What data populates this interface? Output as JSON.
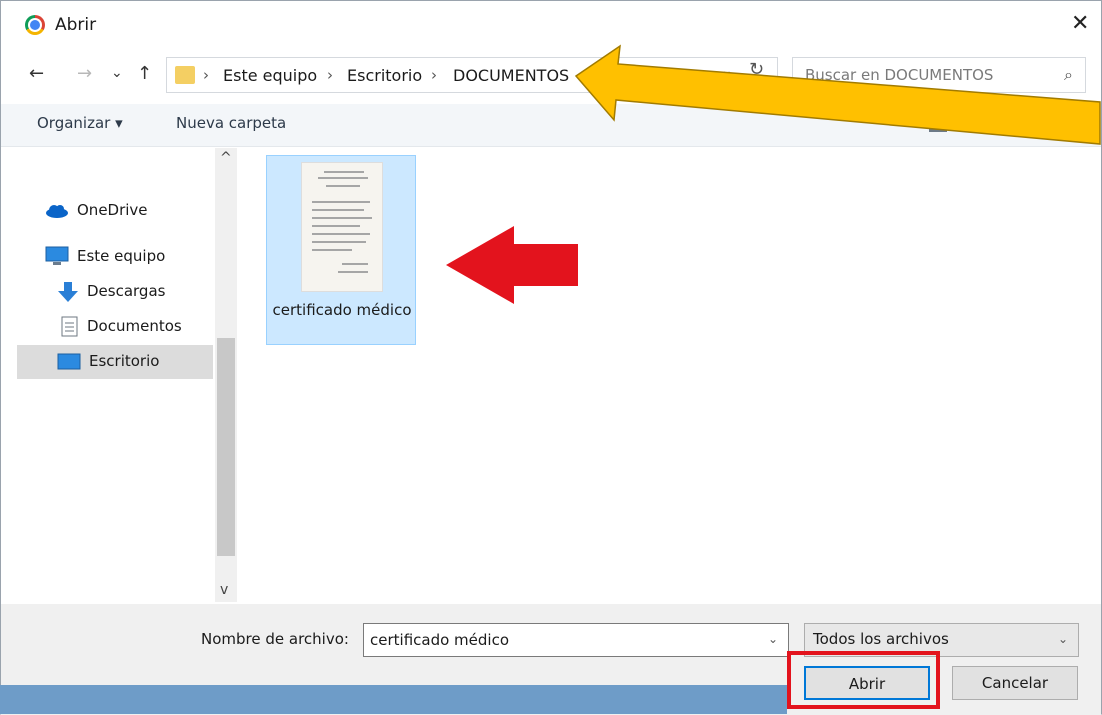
{
  "window": {
    "title": "Abrir",
    "close_glyph": "✕"
  },
  "nav": {
    "back_glyph": "←",
    "forward_glyph": "→",
    "recent_glyph": "⌄",
    "up_glyph": "↑",
    "breadcrumb": [
      "Este equipo",
      "Escritorio",
      "DOCUMENTOS"
    ],
    "separator": "›",
    "refresh_glyph": "↻",
    "dropdown_glyph": "⌄",
    "search_placeholder": "Buscar en DOCUMENTOS",
    "search_icon": "⌕"
  },
  "toolbar": {
    "organize": "Organizar ▾",
    "new_folder": "Nueva carpeta",
    "help_glyph": "?"
  },
  "sidebar": {
    "items": [
      {
        "label": "OneDrive",
        "icon": "cloud-icon"
      },
      {
        "label": "Este equipo",
        "icon": "computer-icon"
      },
      {
        "label": "Descargas",
        "icon": "download-icon"
      },
      {
        "label": "Documentos",
        "icon": "document-icon"
      },
      {
        "label": "Escritorio",
        "icon": "desktop-icon",
        "selected": true
      }
    ],
    "scroll_up": "^",
    "scroll_down": "v"
  },
  "files": [
    {
      "name": "certificado médico"
    }
  ],
  "footer": {
    "filename_label": "Nombre de archivo:",
    "filename_value": "certificado médico",
    "filetype_value": "Todos los archivos",
    "open_label": "Abrir",
    "cancel_label": "Cancelar",
    "dropdown_glyph": "⌄"
  },
  "colors": {
    "selection": "#cce8ff",
    "accent": "#0078d7",
    "highlight_red": "#e3131d",
    "arrow_yellow": "#ffc000"
  }
}
